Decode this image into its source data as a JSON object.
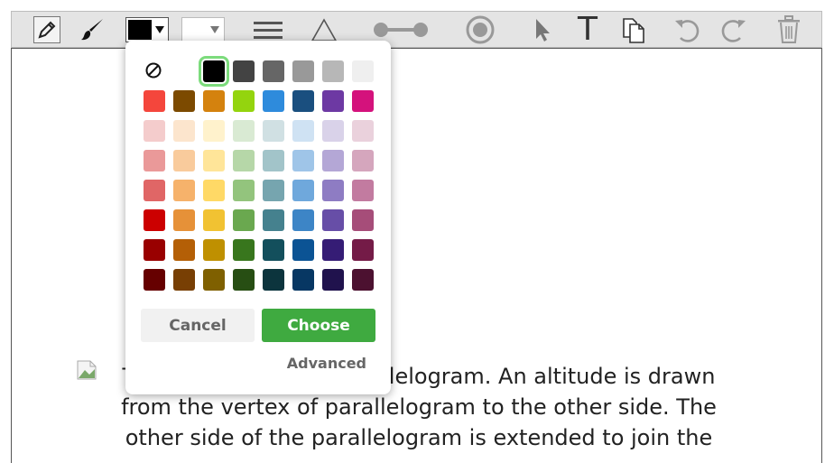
{
  "toolbar": {
    "tools": [
      {
        "name": "pencil-tool",
        "icon": "pencil-icon"
      },
      {
        "name": "brush-tool",
        "icon": "brush-icon"
      },
      {
        "name": "stroke-color-select",
        "icon": "color-swatch-icon",
        "value": "#000000"
      },
      {
        "name": "fill-color-select",
        "icon": "color-swatch-icon",
        "value": "#ffffff"
      },
      {
        "name": "line-width-tool",
        "icon": "lines-icon"
      },
      {
        "name": "shape-tool",
        "icon": "triangle-icon"
      },
      {
        "name": "line-tool",
        "icon": "line-segment-icon"
      },
      {
        "name": "point-tool",
        "icon": "point-icon"
      },
      {
        "name": "select-tool",
        "icon": "cursor-arrow-icon"
      },
      {
        "name": "text-tool",
        "icon": "text-icon",
        "glyph": "T"
      },
      {
        "name": "copy-tool",
        "icon": "copy-icon"
      },
      {
        "name": "undo-tool",
        "icon": "undo-icon"
      },
      {
        "name": "redo-tool",
        "icon": "redo-icon"
      },
      {
        "name": "delete-tool",
        "icon": "trash-icon"
      }
    ]
  },
  "color_picker": {
    "no_color_icon": "no-color-icon",
    "selected_color": "#000000",
    "rows": [
      [
        "#000000",
        "#434343",
        "#666666",
        "#999999",
        "#b7b7b7",
        "#efefef"
      ],
      [
        "#f4463c",
        "#7c4a00",
        "#d4820e",
        "#94d40e",
        "#2e8bdc",
        "#1a4f7f",
        "#6d39a3",
        "#d4127c"
      ],
      [
        "#f4cccc",
        "#fce5cd",
        "#fff2cc",
        "#d9ead3",
        "#d0e0e3",
        "#cfe2f3",
        "#d9d2e9",
        "#ead1dc"
      ],
      [
        "#ea9999",
        "#f9cb9c",
        "#ffe599",
        "#b6d7a8",
        "#a2c4c9",
        "#9fc5e8",
        "#b4a7d6",
        "#d5a6bd"
      ],
      [
        "#e06666",
        "#f6b26b",
        "#ffd966",
        "#93c47d",
        "#76a5af",
        "#6fa8dc",
        "#8e7cc3",
        "#c27ba0"
      ],
      [
        "#cc0000",
        "#e69138",
        "#f1c232",
        "#6aa84f",
        "#45818e",
        "#3d85c6",
        "#674ea7",
        "#a64d79"
      ],
      [
        "#990000",
        "#b45f06",
        "#bf9000",
        "#38761d",
        "#134f5c",
        "#0b5394",
        "#351c75",
        "#741b47"
      ],
      [
        "#660000",
        "#783f04",
        "#7f6000",
        "#274e13",
        "#0c343d",
        "#073763",
        "#20124d",
        "#4c1130"
      ]
    ],
    "cancel_label": "Cancel",
    "choose_label": "Choose",
    "advanced_label": "Advanced"
  },
  "content": {
    "problem_text": "The figure shows a parallelogram. An altitude is drawn from the vertex of parallelogram to the other side. The other side of the parallelogram is extended to join the"
  }
}
